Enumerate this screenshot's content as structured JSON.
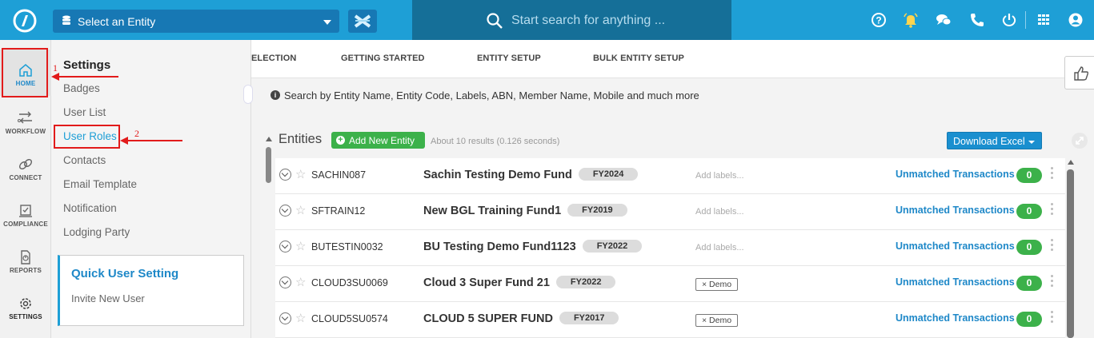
{
  "topbar": {
    "entity_select": "Select an Entity",
    "search_placeholder": "Start search for anything ..."
  },
  "rail": {
    "items": [
      {
        "label": "HOME",
        "icon": "home-icon"
      },
      {
        "label": "WORKFLOW",
        "icon": "workflow-icon"
      },
      {
        "label": "CONNECT",
        "icon": "link-icon"
      },
      {
        "label": "COMPLIANCE",
        "icon": "compliance-icon"
      },
      {
        "label": "REPORTS",
        "icon": "report-icon"
      },
      {
        "label": "SETTINGS",
        "icon": "gear-icon"
      }
    ]
  },
  "settings": {
    "title": "Settings",
    "items": [
      "Badges",
      "User List",
      "User Roles",
      "Contacts",
      "Email Template",
      "Notification",
      "Lodging Party"
    ],
    "active_item": "User Roles",
    "quick_title": "Quick User Setting",
    "quick_link": "Invite New User"
  },
  "annotations": [
    "1",
    "2"
  ],
  "tabs": [
    "ELECTION",
    "GETTING STARTED",
    "ENTITY SETUP",
    "BULK ENTITY SETUP"
  ],
  "hint": "Search by Entity Name, Entity Code, Labels, ABN, Member Name, Mobile and much more",
  "entities": {
    "title": "Entities",
    "add_button": "Add New Entity",
    "results": "About 10 results (0.126 seconds)",
    "download_button": "Download Excel",
    "rows": [
      {
        "code": "SACHIN087",
        "name": "Sachin Testing Demo Fund",
        "fy": "FY2024",
        "labels": "Add labels...",
        "tag": "",
        "link": "Unmatched Transactions",
        "count": "0"
      },
      {
        "code": "SFTRAIN12",
        "name": "New BGL Training Fund1",
        "fy": "FY2019",
        "labels": "Add labels...",
        "tag": "",
        "link": "Unmatched Transactions",
        "count": "0"
      },
      {
        "code": "BUTESTIN0032",
        "name": "BU Testing Demo Fund1123",
        "fy": "FY2022",
        "labels": "Add labels...",
        "tag": "",
        "link": "Unmatched Transactions",
        "count": "0"
      },
      {
        "code": "CLOUD3SU0069",
        "name": "Cloud 3 Super Fund 21",
        "fy": "FY2022",
        "labels": "",
        "tag": "× Demo",
        "link": "Unmatched Transactions",
        "count": "0"
      },
      {
        "code": "CLOUD5SU0574",
        "name": "CLOUD 5 SUPER FUND",
        "fy": "FY2017",
        "labels": "",
        "tag": "× Demo",
        "link": "Unmatched Transactions",
        "count": "0"
      }
    ]
  },
  "colors": {
    "primary": "#1e9fd6",
    "dark_primary": "#1778b4",
    "green": "#3cb14a",
    "annotation": "#e21b1b"
  }
}
